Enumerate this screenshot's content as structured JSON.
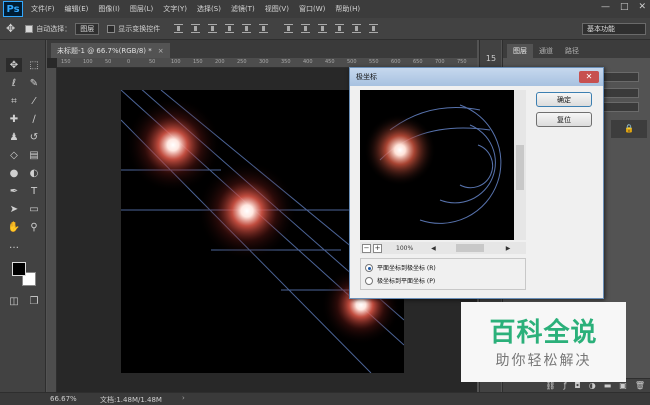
{
  "app": {
    "logo": "Ps",
    "menu": [
      "文件(F)",
      "编辑(E)",
      "图像(I)",
      "图层(L)",
      "文字(Y)",
      "选择(S)",
      "滤镜(T)",
      "视图(V)",
      "窗口(W)",
      "帮助(H)"
    ],
    "window_controls": [
      "—",
      "□",
      "✕"
    ]
  },
  "options_bar": {
    "auto_select_label": "自动选择：",
    "auto_select_value": "图层",
    "show_transform_label": "显示变换控件",
    "workspace": "基本功能"
  },
  "document": {
    "tab_title": "未标题-1 @ 66.7%(RGB/8) *",
    "tab_close": "×",
    "ruler_ticks": [
      "150",
      "100",
      "50",
      "0",
      "50",
      "100",
      "150",
      "200",
      "250",
      "300",
      "350",
      "400",
      "450",
      "500",
      "550",
      "600",
      "650",
      "700",
      "750"
    ]
  },
  "status_bar": {
    "zoom": "66.67%",
    "doc_info": "文档:1.48M/1.48M",
    "arrow": "›"
  },
  "panels": {
    "tabs": [
      "图层",
      "通道",
      "路径"
    ],
    "mini_number": "15"
  },
  "dialog": {
    "title": "极坐标",
    "close": "✕",
    "ok": "确定",
    "reset": "复位",
    "zoom_level": "100%",
    "zoom_minus": "−",
    "zoom_plus": "+",
    "options": [
      {
        "label": "平面坐标到极坐标 (R)",
        "selected": true
      },
      {
        "label": "极坐标到平面坐标 (P)",
        "selected": false
      }
    ]
  },
  "watermark": {
    "main": "百科全说",
    "sub": "助你轻松解决"
  }
}
